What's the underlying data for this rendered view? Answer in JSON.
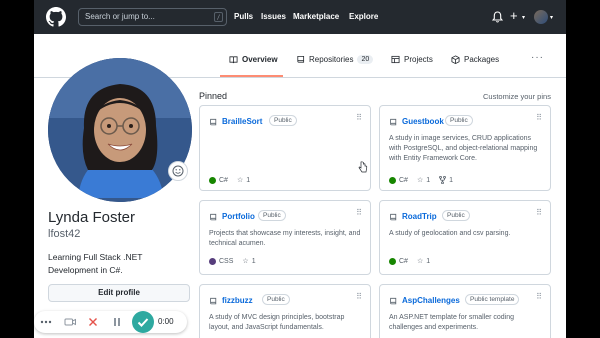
{
  "header": {
    "search_placeholder": "Search or jump to...",
    "search_key": "/",
    "nav": [
      "Pulls",
      "Issues",
      "Marketplace",
      "Explore"
    ]
  },
  "tabs": [
    {
      "label": "Overview",
      "icon": "book-icon",
      "active": true
    },
    {
      "label": "Repositories",
      "icon": "repo-icon",
      "count": "20"
    },
    {
      "label": "Projects",
      "icon": "table-icon"
    },
    {
      "label": "Packages",
      "icon": "package-icon"
    }
  ],
  "tabs_more": "···",
  "profile": {
    "name": "Lynda Foster",
    "login": "lfost42",
    "bio": "Learning Full Stack .NET Development in C#.",
    "edit_label": "Edit profile"
  },
  "pinned": {
    "title": "Pinned",
    "customize": "Customize your pins",
    "cards": [
      {
        "title": "BrailleSort",
        "badge": "Public",
        "description": "",
        "language": "C#",
        "lang_color": "#178600",
        "stars": "1",
        "forks": ""
      },
      {
        "title": "Guestbook",
        "badge": "Public",
        "description": "A study in image services, CRUD applications with PostgreSQL, and object-relational mapping with Entity Framework Core.",
        "language": "C#",
        "lang_color": "#178600",
        "stars": "1",
        "forks": "1"
      },
      {
        "title": "Portfolio",
        "badge": "Public",
        "description": "Projects that showcase my interests, insight, and technical acumen.",
        "language": "CSS",
        "lang_color": "#563d7c",
        "stars": "1",
        "forks": ""
      },
      {
        "title": "RoadTrip",
        "badge": "Public",
        "description": "A study of geolocation and csv parsing.",
        "language": "C#",
        "lang_color": "#178600",
        "stars": "1",
        "forks": ""
      },
      {
        "title": "fizzbuzz",
        "badge": "Public",
        "description": "A study of MVC design principles, bootstrap layout, and JavaScript fundamentals.",
        "language": "",
        "lang_color": "",
        "stars": "",
        "forks": ""
      },
      {
        "title": "AspChallenges",
        "badge": "Public template",
        "description": "An ASP.NET template for smaller coding challenges and experiments.",
        "language": "",
        "lang_color": "",
        "stars": "",
        "forks": ""
      }
    ]
  },
  "recorder": {
    "time": "0:00",
    "accent": "#2ea9a0"
  },
  "colors": {
    "header_bg": "#24292f",
    "link": "#0969da",
    "tab_underline": "#fd8c73"
  }
}
